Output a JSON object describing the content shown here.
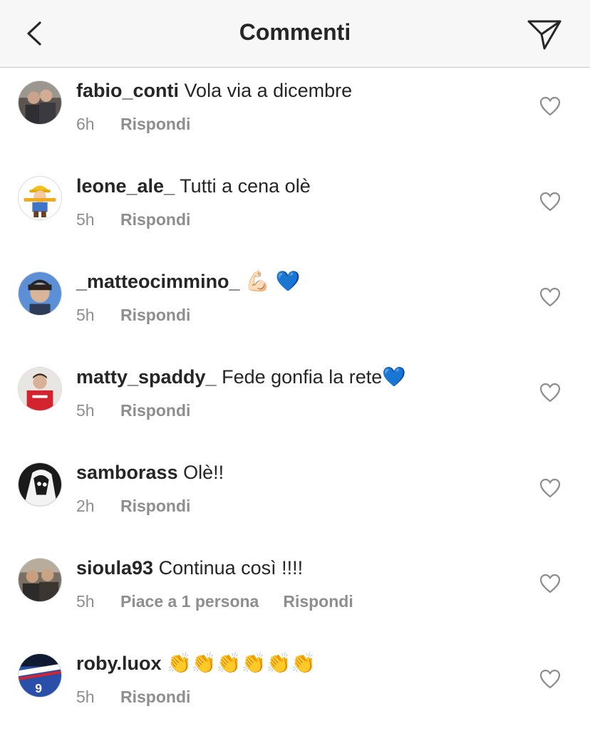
{
  "header": {
    "title": "Commenti"
  },
  "comments": [
    {
      "username": "fabio_conti",
      "text": "Vola via a dicembre",
      "time": "6h",
      "likes": "",
      "reply": "Rispondi",
      "avatar": "photo-two-people"
    },
    {
      "username": "leone_ale_",
      "text": "Tutti a cena olè",
      "time": "5h",
      "likes": "",
      "reply": "Rispondi",
      "avatar": "cartoon-builder"
    },
    {
      "username": "_matteocimmino_",
      "text": "💪🏻 💙",
      "time": "5h",
      "likes": "",
      "reply": "Rispondi",
      "avatar": "photo-face-blue"
    },
    {
      "username": "matty_spaddy_",
      "text": "Fede gonfia la rete💙",
      "time": "5h",
      "likes": "",
      "reply": "Rispondi",
      "avatar": "photo-red-shirt"
    },
    {
      "username": "samborass",
      "text": "Olè!!",
      "time": "2h",
      "likes": "",
      "reply": "Rispondi",
      "avatar": "bw-graphic"
    },
    {
      "username": "sioula93",
      "text": "Continua così !!!!",
      "time": "5h",
      "likes": "Piace a 1 persona",
      "reply": "Rispondi",
      "avatar": "photo-group"
    },
    {
      "username": "roby.luox",
      "text": "👏👏👏👏👏👏",
      "time": "5h",
      "likes": "",
      "reply": "Rispondi",
      "avatar": "photo-jersey-9"
    }
  ]
}
